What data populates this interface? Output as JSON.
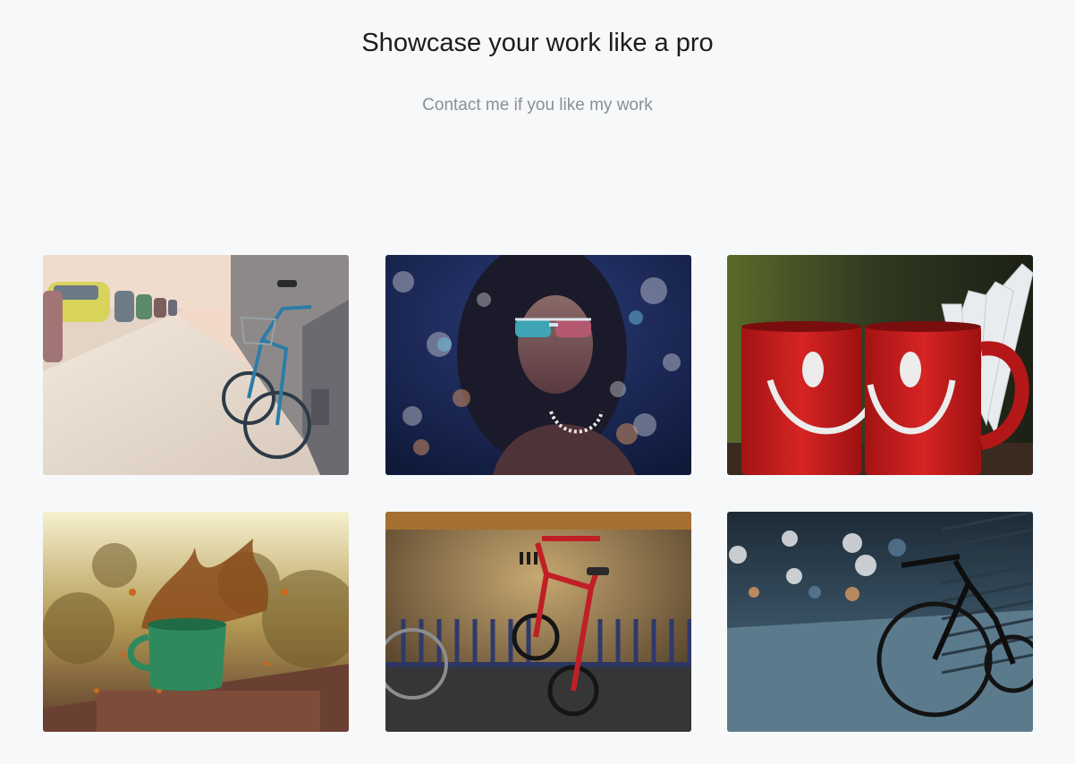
{
  "header": {
    "title": "Showcase your work like a pro",
    "subtitle": "Contact me if you like my work"
  },
  "gallery": {
    "items": [
      {
        "subject": "bicycle parked on city sidewalk",
        "icon": "bicycle-street-photo"
      },
      {
        "subject": "woman with sunglasses and bokeh lights",
        "icon": "portrait-bokeh-photo"
      },
      {
        "subject": "two red smiley mugs with open book",
        "icon": "red-mugs-photo"
      },
      {
        "subject": "green mug with splashing coffee",
        "icon": "coffee-splash-photo"
      },
      {
        "subject": "red bicycle against old wall",
        "icon": "red-bicycle-photo"
      },
      {
        "subject": "black bicycle on night street",
        "icon": "night-bicycle-photo"
      }
    ]
  },
  "colors": {
    "background": "#f6f8f9",
    "title": "#1c1c1c",
    "subtitle": "#8c8f92"
  }
}
